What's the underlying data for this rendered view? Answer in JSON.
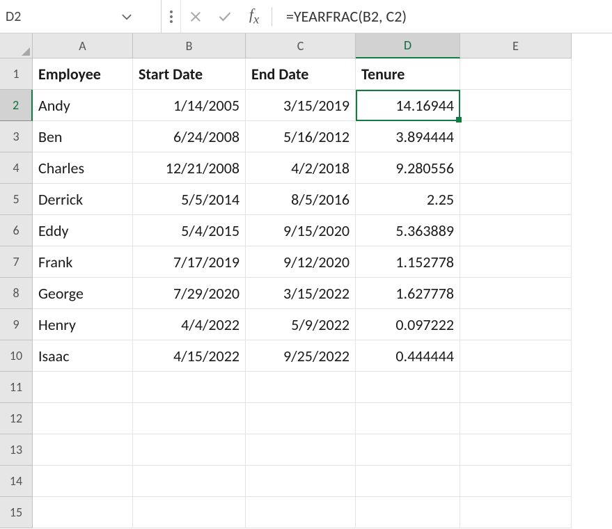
{
  "formula_bar": {
    "cell_ref": "D2",
    "formula": "=YEARFRAC(B2, C2)"
  },
  "columns": [
    "A",
    "B",
    "C",
    "D",
    "E"
  ],
  "row_numbers": [
    "1",
    "2",
    "3",
    "4",
    "5",
    "6",
    "7",
    "8",
    "9",
    "10",
    "11",
    "12",
    "13",
    "14",
    "15"
  ],
  "header": {
    "A": "Employee",
    "B": "Start Date",
    "C": "End Date",
    "D": "Tenure"
  },
  "rows": [
    {
      "A": "Andy",
      "B": "1/14/2005",
      "C": "3/15/2019",
      "D": "14.16944"
    },
    {
      "A": "Ben",
      "B": "6/24/2008",
      "C": "5/16/2012",
      "D": "3.894444"
    },
    {
      "A": "Charles",
      "B": "12/21/2008",
      "C": "4/2/2018",
      "D": "9.280556"
    },
    {
      "A": "Derrick",
      "B": "5/5/2014",
      "C": "8/5/2016",
      "D": "2.25"
    },
    {
      "A": "Eddy",
      "B": "5/4/2015",
      "C": "9/15/2020",
      "D": "5.363889"
    },
    {
      "A": "Frank",
      "B": "7/17/2019",
      "C": "9/12/2020",
      "D": "1.152778"
    },
    {
      "A": "George",
      "B": "7/29/2020",
      "C": "3/15/2022",
      "D": "1.627778"
    },
    {
      "A": "Henry",
      "B": "4/4/2022",
      "C": "5/9/2022",
      "D": "0.097222"
    },
    {
      "A": "Isaac",
      "B": "4/15/2022",
      "C": "9/25/2022",
      "D": "0.444444"
    }
  ],
  "selected_cell": "D2"
}
